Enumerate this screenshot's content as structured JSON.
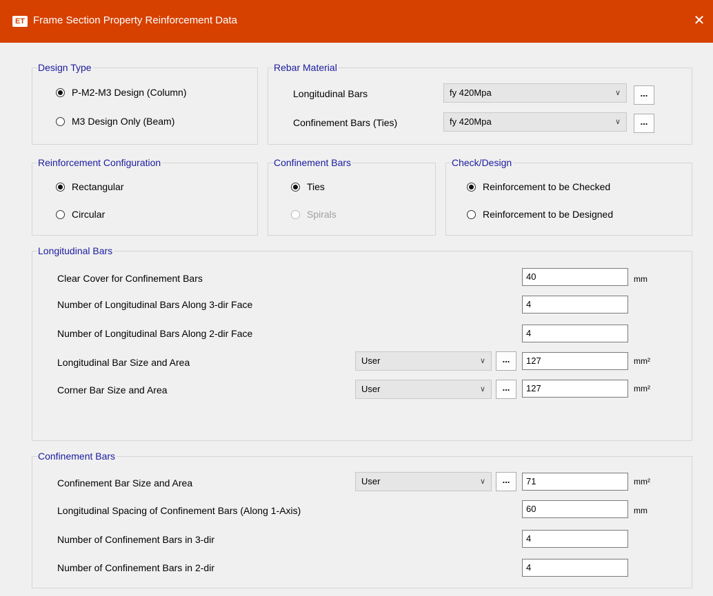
{
  "window": {
    "app_icon": "ET",
    "title": "Frame Section Property Reinforcement Data",
    "close_glyph": "✕"
  },
  "design_type": {
    "legend": "Design Type",
    "options": [
      "P-M2-M3 Design  (Column)",
      "M3 Design Only  (Beam)"
    ],
    "selected": 0
  },
  "rebar_material": {
    "legend": "Rebar Material",
    "longitudinal_label": "Longitudinal Bars",
    "longitudinal_value": "fy 420Mpa",
    "confinement_label": "Confinement Bars (Ties)",
    "confinement_value": "fy 420Mpa",
    "ellipsis": "..."
  },
  "reinforcement_configuration": {
    "legend": "Reinforcement Configuration",
    "options": [
      "Rectangular",
      "Circular"
    ],
    "selected": 0
  },
  "confinement_type": {
    "legend": "Confinement Bars",
    "options": [
      "Ties",
      "Spirals"
    ],
    "selected": 0,
    "disabled": [
      "Spirals"
    ]
  },
  "check_design": {
    "legend": "Check/Design",
    "options": [
      "Reinforcement to be Checked",
      "Reinforcement to be Designed"
    ],
    "selected": 0
  },
  "longitudinal_bars": {
    "legend": "Longitudinal Bars",
    "clear_cover_label": "Clear Cover for Confinement Bars",
    "clear_cover_value": "40",
    "clear_cover_unit": "mm",
    "bars_3dir_label": "Number of Longitudinal Bars Along 3-dir Face",
    "bars_3dir_value": "4",
    "bars_2dir_label": "Number of Longitudinal Bars Along 2-dir Face",
    "bars_2dir_value": "4",
    "bar_size_label": "Longitudinal Bar Size and Area",
    "bar_size_select": "User",
    "bar_size_area": "127",
    "bar_size_unit": "mm²",
    "corner_label": "Corner Bar Size and Area",
    "corner_select": "User",
    "corner_area": "127",
    "corner_unit": "mm²"
  },
  "confinement_bars": {
    "legend": "Confinement Bars",
    "size_label": "Confinement Bar Size and Area",
    "size_select": "User",
    "size_area": "71",
    "size_unit": "mm²",
    "spacing_label": "Longitudinal Spacing of Confinement Bars  (Along 1-Axis)",
    "spacing_value": "60",
    "spacing_unit": "mm",
    "num_3dir_label": "Number of Confinement Bars in 3-dir",
    "num_3dir_value": "4",
    "num_2dir_label": "Number of Confinement Bars in 2-dir",
    "num_2dir_value": "4"
  }
}
